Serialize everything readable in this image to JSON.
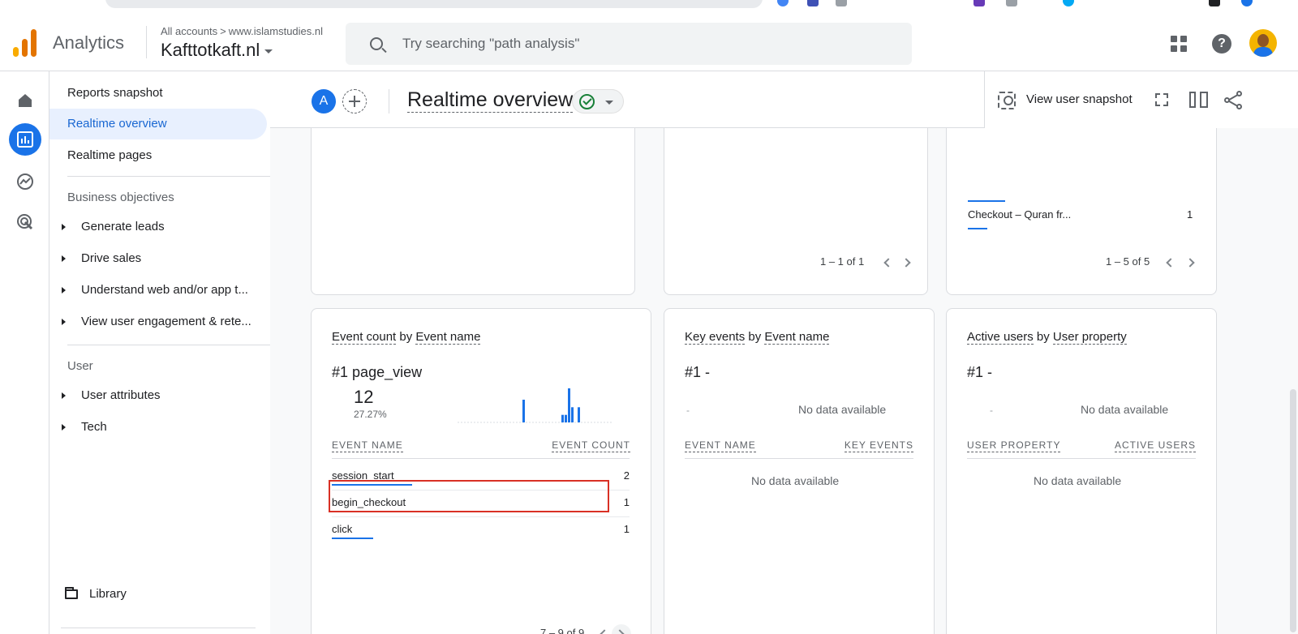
{
  "header": {
    "app_name": "Analytics",
    "crumb_all": "All accounts",
    "crumb_sep": ">",
    "crumb_site": "www.islamstudies.nl",
    "property": "Kafttotkaft.nl",
    "search_placeholder": "Try searching \"path analysis\"",
    "help_glyph": "?",
    "logo_colors": [
      "#f9ab00",
      "#e37400",
      "#e37400"
    ]
  },
  "sidebar": {
    "top_items": [
      {
        "label": "Reports snapshot"
      },
      {
        "label": "Realtime overview",
        "active": true
      },
      {
        "label": "Realtime pages"
      }
    ],
    "sections": [
      {
        "title": "Business objectives",
        "items": [
          "Generate leads",
          "Drive sales",
          "Understand web and/or app t...",
          "View user engagement & rete..."
        ]
      },
      {
        "title": "User",
        "items": [
          "User attributes",
          "Tech"
        ]
      }
    ],
    "library": "Library"
  },
  "toolbar": {
    "segment_letter": "A",
    "title": "Realtime overview",
    "view_snapshot": "View user snapshot"
  },
  "top_cards": {
    "middle_pager": "1 – 1 of 1",
    "right_row_name": "Checkout – Quran fr...",
    "right_row_count": "1",
    "right_pager": "1 – 5 of 5"
  },
  "event_card": {
    "title_metric": "Event count",
    "title_by": "by",
    "title_dim": "Event name",
    "rank": "#1",
    "top_name": "page_view",
    "top_value": "12",
    "top_pct": "27.27%",
    "col_name": "EVENT NAME",
    "col_count": "EVENT COUNT",
    "rows": [
      {
        "name": "session_start",
        "count": "2",
        "bar": 0.27
      },
      {
        "name": "begin_checkout",
        "count": "1",
        "bar": 0.25
      },
      {
        "name": "click",
        "count": "1",
        "bar": 0.14
      }
    ],
    "pager": "7 – 9 of 9",
    "sparkline": [
      0,
      0,
      0,
      0,
      0,
      0,
      0,
      0,
      0,
      0,
      0,
      0,
      0,
      0,
      0,
      0,
      0,
      0,
      0,
      0,
      6,
      0,
      0,
      0,
      0,
      0,
      0,
      0,
      0,
      0,
      0,
      0,
      2,
      2,
      9,
      4,
      0,
      4,
      0,
      0,
      0,
      0,
      0,
      0,
      0,
      0,
      0,
      0
    ]
  },
  "key_card": {
    "title_metric": "Key events",
    "title_by": "by",
    "title_dim": "Event name",
    "rank": "#1",
    "rank_value": "-",
    "mini_dash": "-",
    "no_data_chart": "No data available",
    "col_name": "EVENT NAME",
    "col_count": "KEY EVENTS",
    "no_data_table": "No data available"
  },
  "user_card": {
    "title_metric": "Active users",
    "title_by": "by",
    "title_dim": "User property",
    "rank": "#1",
    "rank_value": "-",
    "mini_dash": "-",
    "no_data_chart": "No data available",
    "col_name": "USER PROPERTY",
    "col_count": "ACTIVE USERS",
    "no_data_table": "No data available"
  }
}
